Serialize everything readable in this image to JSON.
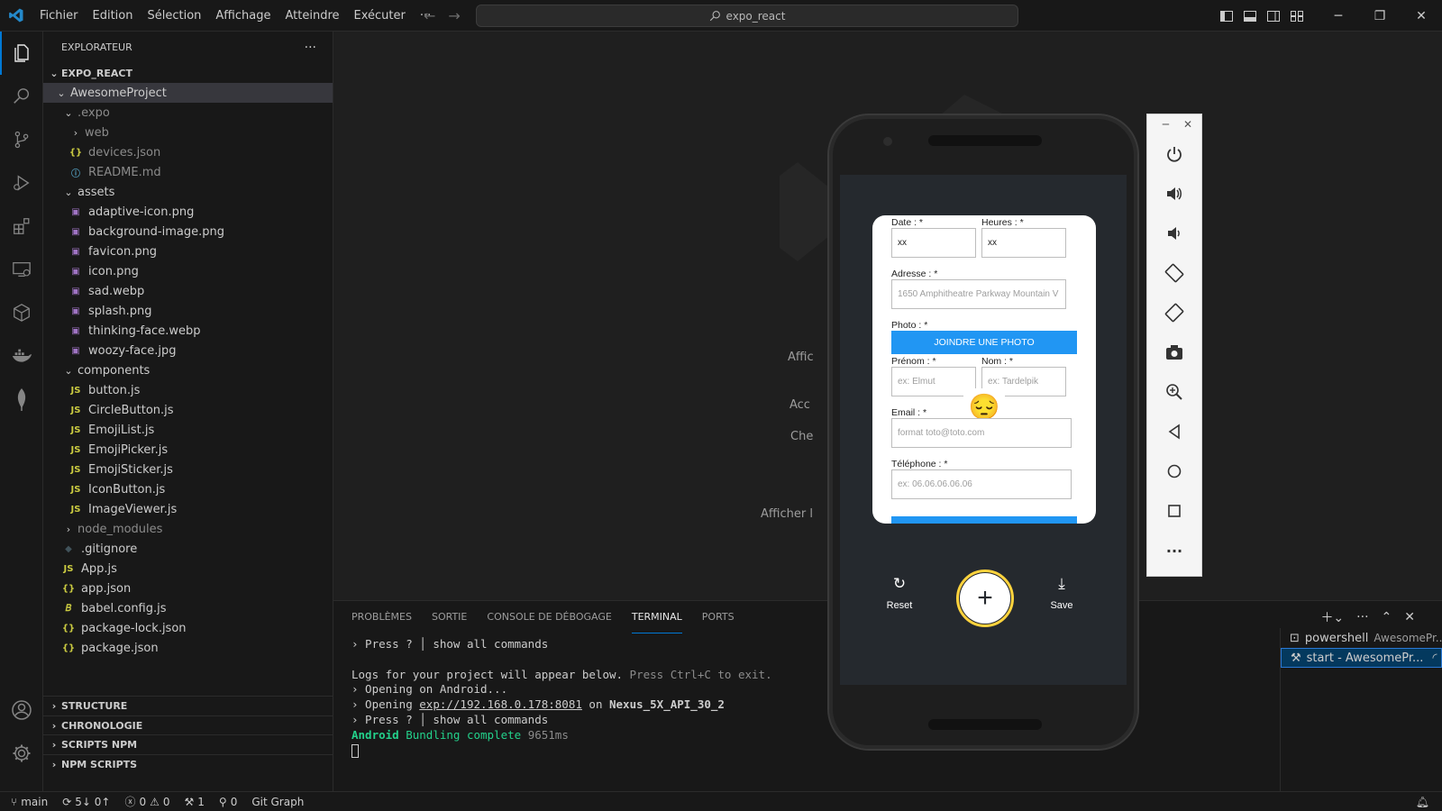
{
  "menu": [
    "Fichier",
    "Edition",
    "Sélection",
    "Affichage",
    "Atteindre",
    "Exécuter",
    "···"
  ],
  "search": {
    "text": "expo_react"
  },
  "sidebar": {
    "title": "EXPLORATEUR",
    "more": "···",
    "root": "EXPO_REACT",
    "tree": [
      {
        "label": "AwesomeProject",
        "type": "folder-open",
        "depth": 1,
        "selected": true
      },
      {
        "label": ".expo",
        "type": "folder-open",
        "depth": 2,
        "dim": true
      },
      {
        "label": "web",
        "type": "folder",
        "depth": 3,
        "dim": true
      },
      {
        "label": "devices.json",
        "type": "json",
        "depth": 3,
        "dim": true
      },
      {
        "label": "README.md",
        "type": "info",
        "depth": 3,
        "dim": true
      },
      {
        "label": "assets",
        "type": "folder-open",
        "depth": 2
      },
      {
        "label": "adaptive-icon.png",
        "type": "image",
        "depth": 3
      },
      {
        "label": "background-image.png",
        "type": "image",
        "depth": 3
      },
      {
        "label": "favicon.png",
        "type": "image",
        "depth": 3
      },
      {
        "label": "icon.png",
        "type": "image",
        "depth": 3
      },
      {
        "label": "sad.webp",
        "type": "image",
        "depth": 3
      },
      {
        "label": "splash.png",
        "type": "image",
        "depth": 3
      },
      {
        "label": "thinking-face.webp",
        "type": "image",
        "depth": 3
      },
      {
        "label": "woozy-face.jpg",
        "type": "image",
        "depth": 3
      },
      {
        "label": "components",
        "type": "folder-open",
        "depth": 2
      },
      {
        "label": "button.js",
        "type": "js",
        "depth": 3
      },
      {
        "label": "CircleButton.js",
        "type": "js",
        "depth": 3
      },
      {
        "label": "EmojiList.js",
        "type": "js",
        "depth": 3
      },
      {
        "label": "EmojiPicker.js",
        "type": "js",
        "depth": 3
      },
      {
        "label": "EmojiSticker.js",
        "type": "js",
        "depth": 3
      },
      {
        "label": "IconButton.js",
        "type": "js",
        "depth": 3
      },
      {
        "label": "ImageViewer.js",
        "type": "js",
        "depth": 3
      },
      {
        "label": "node_modules",
        "type": "folder",
        "depth": 2,
        "dim": true
      },
      {
        "label": ".gitignore",
        "type": "git",
        "depth": 2
      },
      {
        "label": "App.js",
        "type": "js",
        "depth": 2
      },
      {
        "label": "app.json",
        "type": "json",
        "depth": 2
      },
      {
        "label": "babel.config.js",
        "type": "babel",
        "depth": 2
      },
      {
        "label": "package-lock.json",
        "type": "json",
        "depth": 2
      },
      {
        "label": "package.json",
        "type": "json",
        "depth": 2
      }
    ],
    "sections": [
      "STRUCTURE",
      "CHRONOLOGIE",
      "SCRIPTS NPM",
      "NPM SCRIPTS"
    ]
  },
  "editor_hints": [
    "Affic",
    "Acc",
    "Che",
    "Afficher l"
  ],
  "panel": {
    "tabs": [
      "PROBLÈMES",
      "SORTIE",
      "CONSOLE DE DÉBOGAGE",
      "TERMINAL",
      "PORTS"
    ],
    "active_tab": "TERMINAL",
    "terminal": {
      "l1_prefix": "› Press ? │ ",
      "l1_text": "show all commands",
      "l2_a": "Logs for your project will appear below.",
      "l2_b": " Press Ctrl+C to exit.",
      "l3": "› Opening on Android...",
      "l4_a": "› Opening ",
      "l4_url": "exp://192.168.0.178:8081",
      "l4_b": " on ",
      "l4_device": "Nexus_5X_API_30_2",
      "l5_prefix": "› Press ? │ ",
      "l5_text": "show all commands",
      "l6_a": "Android",
      "l6_b": " Bundling complete ",
      "l6_c": "9651ms"
    },
    "terminals": [
      {
        "name": "powershell",
        "sub": "AwesomePr..."
      },
      {
        "name": "start - AwesomePr..."
      }
    ]
  },
  "phone": {
    "form": {
      "date_label": "Date : *",
      "date_value": "xx",
      "hours_label": "Heures : *",
      "hours_value": "xx",
      "address_label": "Adresse : *",
      "address_placeholder": "1650 Amphitheatre Parkway Mountain V",
      "photo_label": "Photo : *",
      "photo_button": "JOINDRE UNE PHOTO",
      "firstname_label": "Prénom : *",
      "firstname_placeholder": "ex: Elmut",
      "lastname_label": "Nom : *",
      "lastname_placeholder": "ex: Tardelpik",
      "email_label": "Email : *",
      "email_placeholder": "format toto@toto.com",
      "phone_label": "Téléphone : *",
      "phone_placeholder": "ex: 06.06.06.06.06",
      "emoji": "😔"
    },
    "reset_label": "Reset",
    "save_label": "Save",
    "add_symbol": "+"
  },
  "statusbar": {
    "branch": "main",
    "sync": "5↓ 0↑",
    "errors": "0",
    "warnings": "0",
    "tools": "1",
    "ports": "0",
    "gitgraph": "Git Graph"
  },
  "colors": {
    "accent": "#0078d4",
    "form_button": "#2196f3",
    "add_ring": "#ffd33d",
    "terminal_green": "#23d18b"
  }
}
